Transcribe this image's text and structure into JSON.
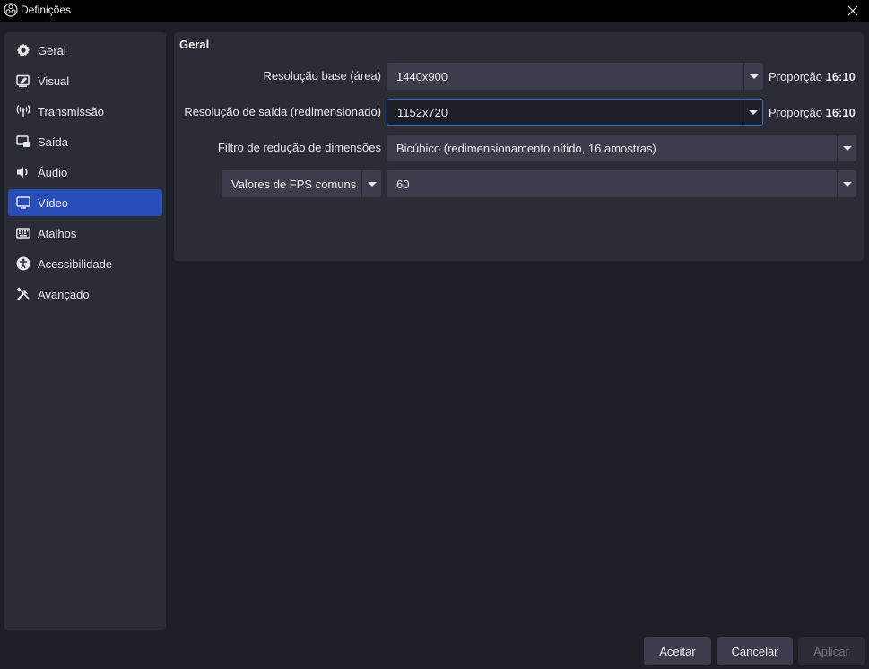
{
  "window": {
    "title": "Definições",
    "app_icon": "obs-logo-icon",
    "close_icon": "close-icon"
  },
  "sidebar": {
    "items": [
      {
        "label": "Geral",
        "icon": "gear-icon"
      },
      {
        "label": "Visual",
        "icon": "appearance-icon"
      },
      {
        "label": "Transmissão",
        "icon": "broadcast-icon"
      },
      {
        "label": "Saída",
        "icon": "output-icon"
      },
      {
        "label": "Áudio",
        "icon": "speaker-icon"
      },
      {
        "label": "Vídeo",
        "icon": "monitor-icon",
        "active": true
      },
      {
        "label": "Atalhos",
        "icon": "keyboard-icon"
      },
      {
        "label": "Acessibilidade",
        "icon": "accessibility-icon"
      },
      {
        "label": "Avançado",
        "icon": "tools-icon"
      }
    ]
  },
  "main": {
    "section_title": "Geral",
    "base_resolution": {
      "label": "Resolução base (área)",
      "value": "1440x900",
      "ratio_prefix": "Proporção",
      "ratio": "16:10"
    },
    "output_resolution": {
      "label": "Resolução de saída (redimensionado)",
      "value": "1152x720",
      "ratio_prefix": "Proporção",
      "ratio": "16:10"
    },
    "downscale_filter": {
      "label": "Filtro de redução de dimensões",
      "value": "Bicúbico (redimensionamento nítido, 16 amostras)"
    },
    "fps": {
      "type_label": "Valores de FPS comuns",
      "value": "60"
    }
  },
  "footer": {
    "accept": "Aceitar",
    "cancel": "Cancelar",
    "apply": "Aplicar"
  },
  "colors": {
    "accent": "#284cb8",
    "focus_border": "#3d6bd4",
    "panel": "#2a2d36",
    "background": "#1d1f26",
    "input": "#3b3e4a"
  }
}
